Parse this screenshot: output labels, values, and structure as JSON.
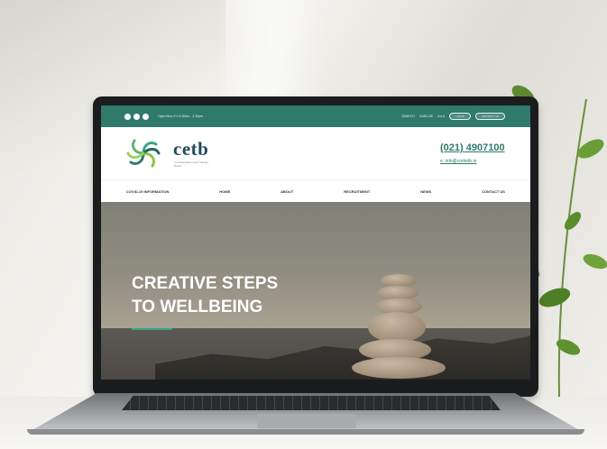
{
  "site": {
    "topbar": {
      "hours": "Open Mon-Fri: 8.30am - 4.30pm",
      "links": [
        "SEARCH",
        "GAEILGE",
        "A A A"
      ],
      "buttons": [
        "LOGIN",
        "CONTACT US"
      ],
      "color": "#2f7a6b"
    },
    "logo": {
      "text": "cetb",
      "subtitle": "Cork Education and Training Board"
    },
    "contact": {
      "phone": "(021) 4907100",
      "email": "e: info@corketb.ie"
    },
    "nav": [
      "COVID-19 INFORMATION",
      "HOME",
      "ABOUT",
      "RECRUITMENT",
      "NEWS",
      "CONTACT US"
    ],
    "hero": {
      "line1": "CREATIVE STEPS",
      "line2": "TO WELLBEING",
      "accent": "#3aa38a"
    }
  }
}
